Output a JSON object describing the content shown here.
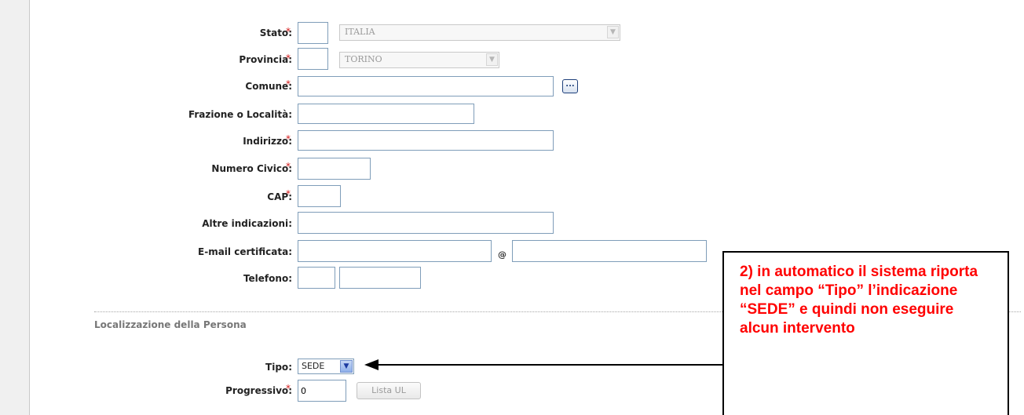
{
  "form": {
    "stato": {
      "label": "Stato",
      "value": "",
      "select": "ITALIA"
    },
    "provincia": {
      "label": "Provincia",
      "value": "",
      "select": "TORINO"
    },
    "comune": {
      "label": "Comune",
      "value": "",
      "lookup": "..."
    },
    "frazione": {
      "label": "Frazione o Località",
      "value": ""
    },
    "indirizzo": {
      "label": "Indirizzo",
      "value": ""
    },
    "numero_civico": {
      "label": "Numero Civico",
      "value": ""
    },
    "cap": {
      "label": "CAP",
      "value": ""
    },
    "altre": {
      "label": "Altre indicazioni",
      "value": ""
    },
    "email": {
      "label": "E-mail certificata",
      "user": "",
      "at": "@",
      "domain": ""
    },
    "telefono": {
      "label": "Telefono",
      "prefix": "",
      "number": ""
    },
    "colon": ":",
    "required": "*"
  },
  "localizzazione": {
    "title": "Localizzazione della Persona",
    "tipo": {
      "label": "Tipo",
      "value": "SEDE"
    },
    "progressivo": {
      "label": "Progressivo",
      "value": "0"
    },
    "lista_button": "Lista UL"
  },
  "annotation": {
    "text": "2) in automatico il sistema riporta nel campo “Tipo” l’indicazione “SEDE” e quindi non eseguire alcun intervento",
    "color": "#ff0000"
  },
  "colors": {
    "required": "#d41a1a",
    "input_border": "#7f9db9"
  }
}
